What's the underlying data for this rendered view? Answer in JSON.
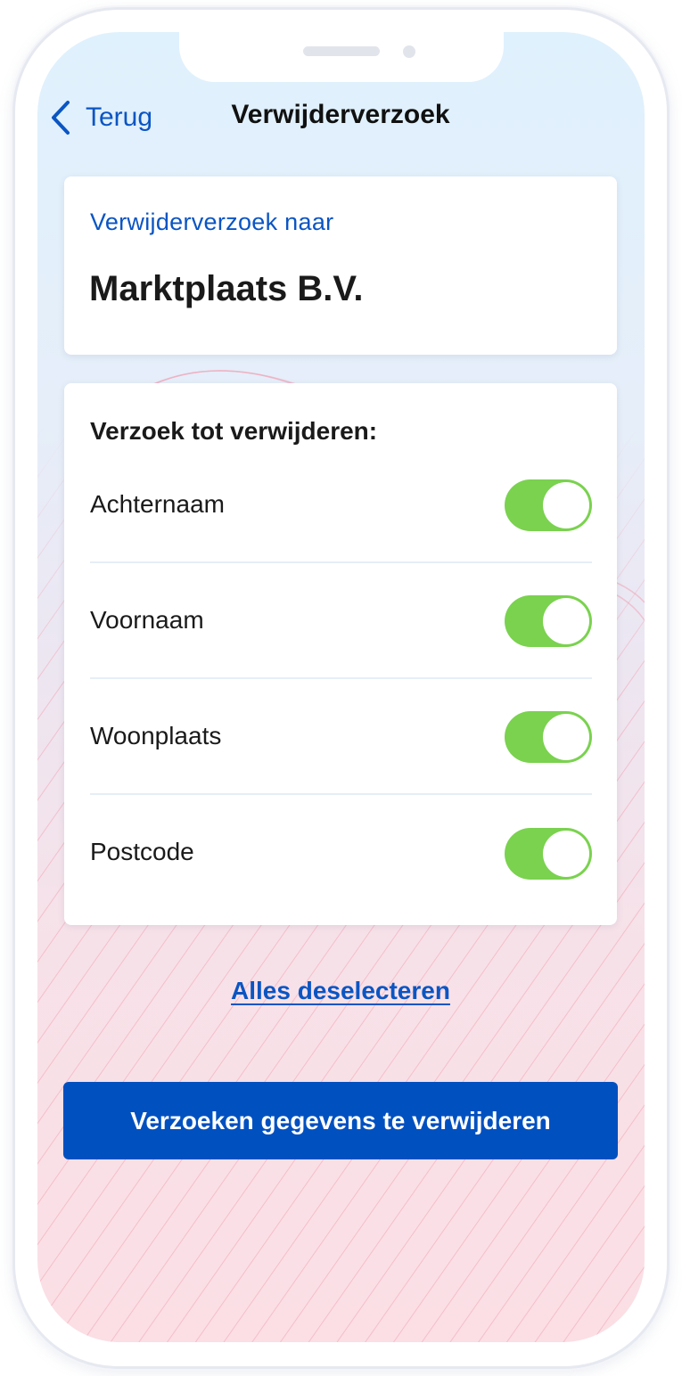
{
  "nav": {
    "back_label": "Terug",
    "title": "Verwijderverzoek"
  },
  "recipient": {
    "label": "Verwijderverzoek naar",
    "name": "Marktplaats B.V."
  },
  "request": {
    "title": "Verzoek tot verwijderen:",
    "fields": [
      {
        "label": "Achternaam",
        "enabled": true
      },
      {
        "label": "Voornaam",
        "enabled": true
      },
      {
        "label": "Woonplaats",
        "enabled": true
      },
      {
        "label": "Postcode",
        "enabled": true
      }
    ]
  },
  "actions": {
    "deselect_all": "Alles deselecteren",
    "submit": "Verzoeken gegevens te verwijderen"
  },
  "colors": {
    "accent": "#0b55c3",
    "primary_button": "#0050c0",
    "toggle_on": "#7ad24f"
  },
  "icons": {
    "back": "chevron-left-icon"
  }
}
